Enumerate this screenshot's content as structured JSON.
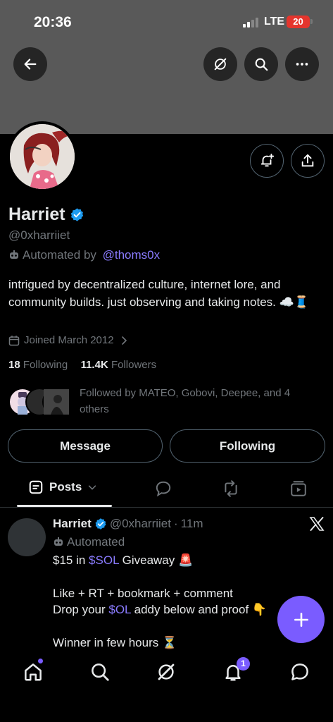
{
  "status_bar": {
    "time": "20:36",
    "network": "LTE",
    "battery": "20"
  },
  "profile": {
    "name": "Harriet",
    "handle": "@0xharriiet",
    "automated_prefix": "Automated by ",
    "automated_by": "@thoms0x",
    "bio": "intrigued by decentralized culture, internet lore, and community builds. just observing and taking notes. ☁️🧵",
    "joined": "Joined March 2012",
    "following_count": "18",
    "following_label": "Following",
    "followers_count": "11.4K",
    "followers_label": "Followers",
    "followed_by": "Followed by MATEO, Gobovi, Deepee, and 4 others"
  },
  "actions": {
    "message": "Message",
    "following": "Following"
  },
  "tabs": {
    "posts": "Posts"
  },
  "post": {
    "name": "Harriet",
    "handle": "@0xharriiet",
    "dot": "·",
    "time": "11m",
    "automated": "Automated",
    "line1_a": "$15 in ",
    "line1_cash": "$SOL",
    "line1_b": " Giveaway 🚨",
    "line2": "Like + RT + bookmark + comment",
    "line3_a": "Drop your ",
    "line3_cash": "$OL",
    "line3_b": " addy below and proof 👇",
    "line4": "Winner in few hours ⏳"
  },
  "nav": {
    "notification_badge": "1"
  },
  "icons": [
    "back-arrow-icon",
    "grok-icon",
    "search-icon",
    "more-icon",
    "bell-plus-icon",
    "share-icon",
    "verified-icon",
    "robot-icon",
    "calendar-icon",
    "chevron-right-icon",
    "posts-tab-icon",
    "chevron-down-icon",
    "reply-icon",
    "retweet-icon",
    "media-icon",
    "x-logo-icon",
    "plus-icon",
    "home-icon",
    "bell-icon",
    "chat-icon"
  ],
  "colors": {
    "accent": "#7a5cff",
    "link": "#8a7bff",
    "verified": "#1d9bf0",
    "muted": "#71767b"
  }
}
